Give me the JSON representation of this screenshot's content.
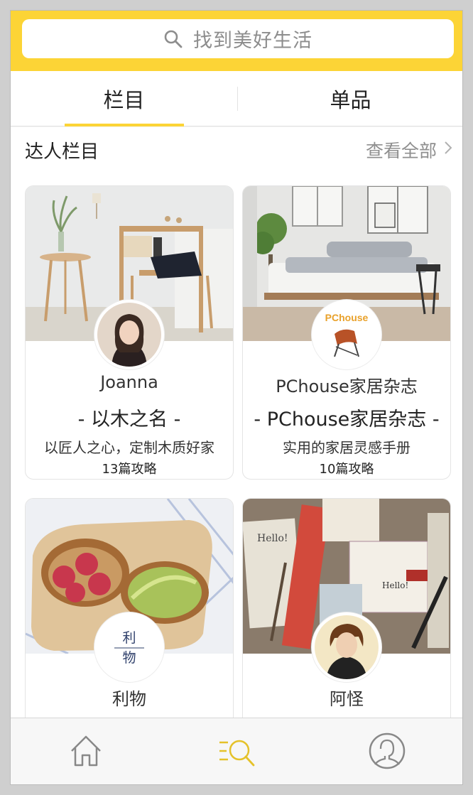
{
  "search": {
    "placeholder": "找到美好生活",
    "icon": "search-icon"
  },
  "tabs": [
    {
      "label": "栏目",
      "active": true
    },
    {
      "label": "单品",
      "active": false
    }
  ],
  "section": {
    "title": "达人栏目",
    "more_label": "查看全部",
    "more_icon": "chevron-right-icon"
  },
  "cards": [
    {
      "name": "Joanna",
      "column_title": "- 以木之名 -",
      "description": "以匠人之心，定制木质好家",
      "count": "13篇攻略"
    },
    {
      "name": "PChouse家居杂志",
      "column_title": "- PChouse家居杂志 -",
      "description": "实用的家居灵感手册",
      "count": "10篇攻略",
      "logo_text": "PChouse"
    },
    {
      "name": "利物",
      "logo_text": "利 物"
    },
    {
      "name": "阿怪"
    }
  ],
  "bottom_nav": [
    {
      "icon": "home-icon",
      "active": false
    },
    {
      "icon": "discover-icon",
      "active": true
    },
    {
      "icon": "profile-icon",
      "active": false
    }
  ],
  "colors": {
    "accent": "#fcd436",
    "text": "#222222",
    "muted": "#8f8f8f"
  }
}
